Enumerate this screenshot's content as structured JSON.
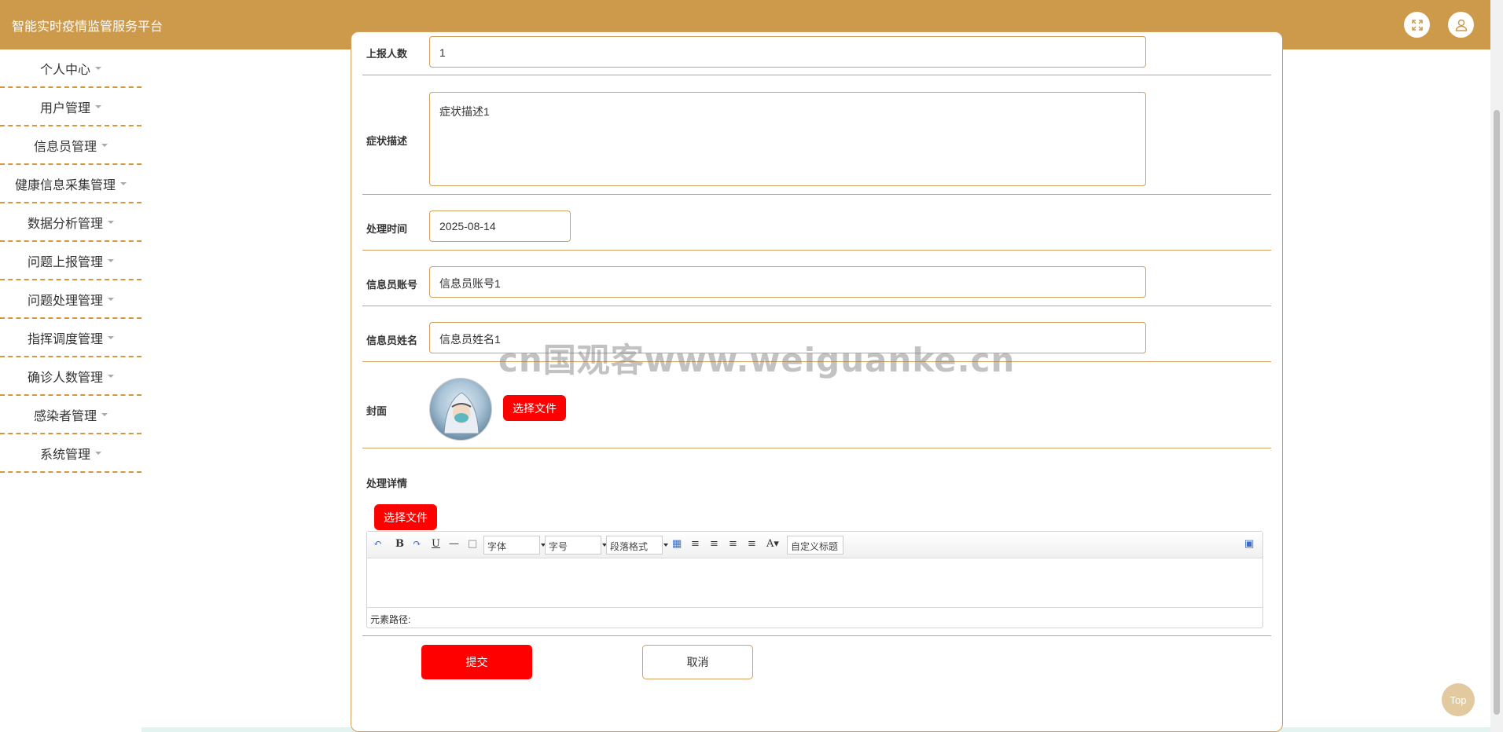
{
  "header": {
    "title": "智能实时疫情监管服务平台"
  },
  "sidebar": {
    "items": [
      {
        "label": "个人中心"
      },
      {
        "label": "用户管理"
      },
      {
        "label": "信息员管理"
      },
      {
        "label": "健康信息采集管理"
      },
      {
        "label": "数据分析管理"
      },
      {
        "label": "问题上报管理"
      },
      {
        "label": "问题处理管理"
      },
      {
        "label": "指挥调度管理"
      },
      {
        "label": "确诊人数管理"
      },
      {
        "label": "感染者管理"
      },
      {
        "label": "系统管理"
      }
    ]
  },
  "form": {
    "reported_count": {
      "label": "上报人数",
      "value": "1"
    },
    "symptom": {
      "label": "症状描述",
      "value": "症状描述1"
    },
    "process_time": {
      "label": "处理时间",
      "value": "2025-08-14"
    },
    "informant_account": {
      "label": "信息员账号",
      "value": "信息员账号1"
    },
    "informant_name": {
      "label": "信息员姓名",
      "value": "信息员姓名1"
    },
    "cover": {
      "label": "封面",
      "button": "选择文件"
    },
    "details": {
      "label": "处理详情",
      "button": "选择文件"
    },
    "submit": "提交",
    "cancel": "取消"
  },
  "editor": {
    "font_family": "字体",
    "font_size": "字号",
    "paragraph": "段落格式",
    "custom_title": "自定义标题",
    "element_path": "元素路径:"
  },
  "top_button": "Top",
  "watermark": "cn国观客www.weiguanke.cn"
}
